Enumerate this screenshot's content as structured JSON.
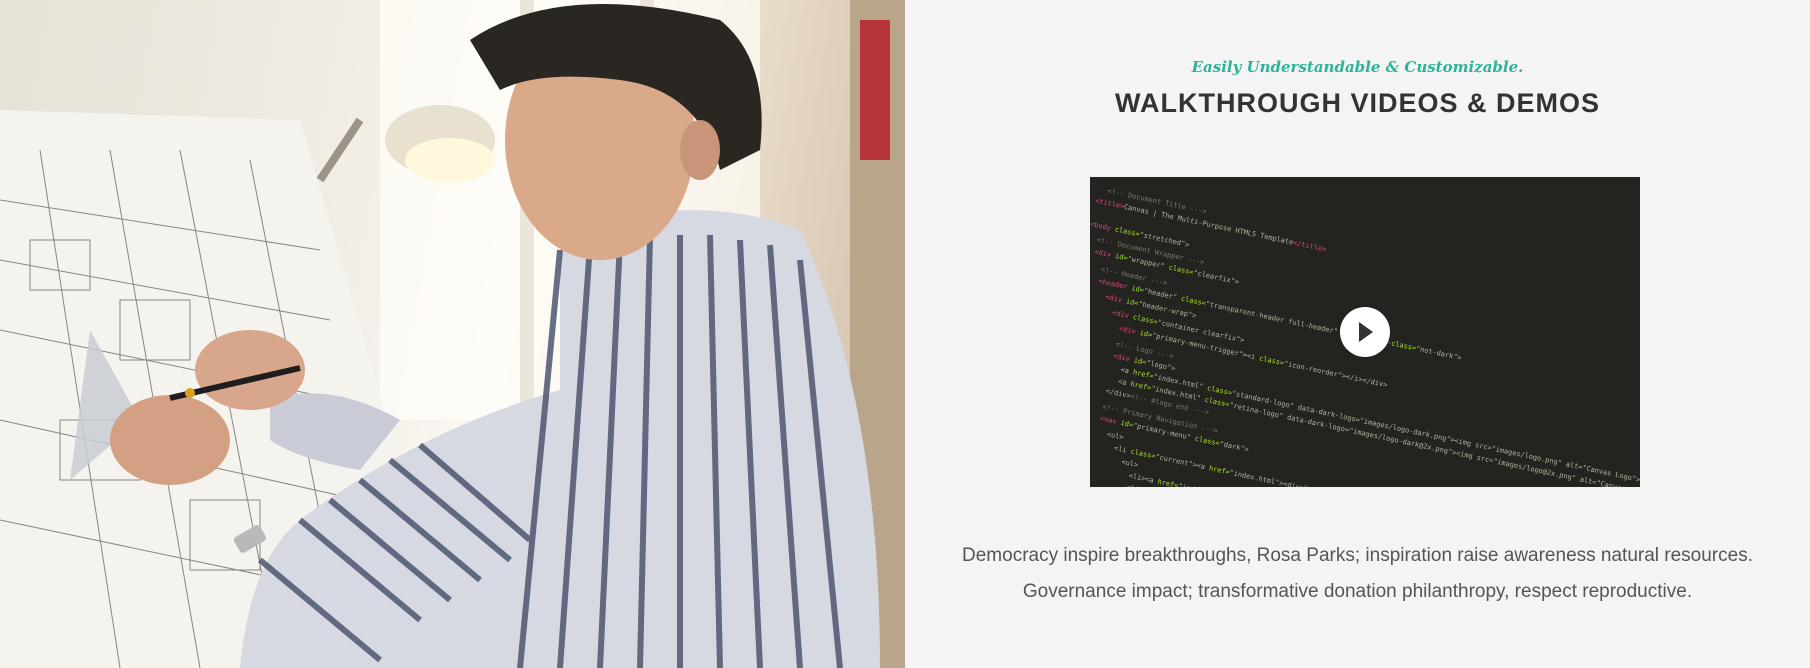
{
  "photo": {
    "description_icon": "architect-drafting-photo"
  },
  "section": {
    "subtitle": "Easily Understandable & Customizable.",
    "title": "WALKTHROUGH VIDEOS & DEMOS"
  },
  "video": {
    "play_icon": "play-icon"
  },
  "description": {
    "line1": "Democracy inspire breakthroughs, Rosa Parks; inspiration raise awareness natural resources.",
    "line2": "Governance impact; transformative donation philanthropy, respect reproductive."
  },
  "colors": {
    "accent": "#2db39a",
    "heading": "#333333",
    "body_text": "#555555",
    "background": "#f4f4f4",
    "video_bg": "#23231f"
  }
}
